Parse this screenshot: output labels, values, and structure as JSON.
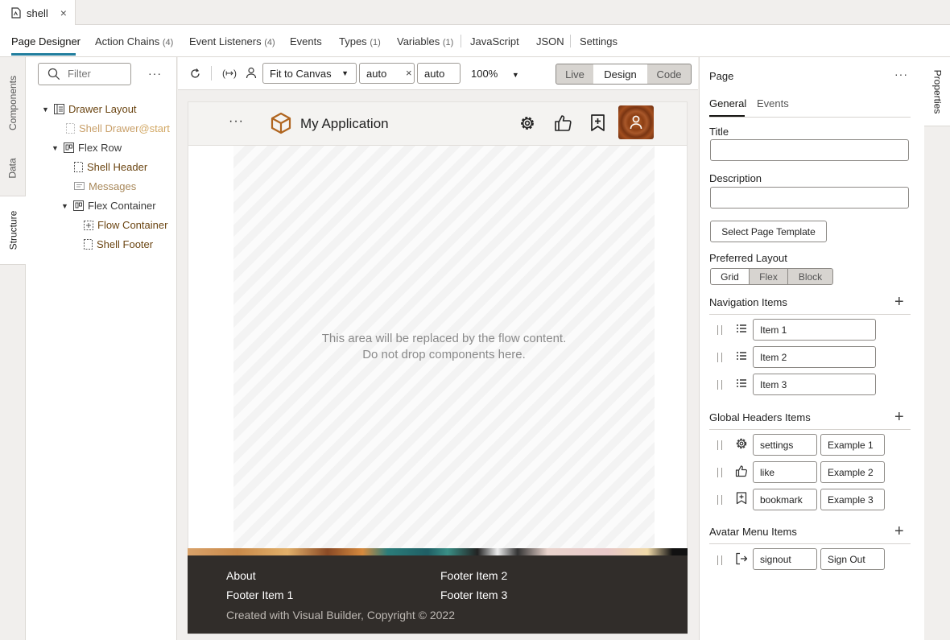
{
  "file_tab": {
    "label": "shell",
    "close": "×"
  },
  "designer_tabs": [
    {
      "label": "Page Designer",
      "count": ""
    },
    {
      "label": "Action Chains",
      "count": "(4)"
    },
    {
      "label": "Event Listeners",
      "count": "(4)"
    },
    {
      "label": "Events",
      "count": ""
    },
    {
      "label": "Types",
      "count": "(1)"
    },
    {
      "label": "Variables",
      "count": "(1)"
    },
    {
      "label": "JavaScript",
      "count": ""
    },
    {
      "label": "JSON",
      "count": ""
    },
    {
      "label": "Settings",
      "count": ""
    }
  ],
  "left_rail": {
    "components": "Components",
    "data": "Data",
    "structure": "Structure"
  },
  "structure": {
    "filter_placeholder": "Filter",
    "more": "···",
    "nodes": [
      {
        "label": "Drawer Layout",
        "slot": ""
      },
      {
        "label": "Shell Drawer",
        "slot": "@start"
      },
      {
        "label": "Flex Row",
        "slot": ""
      },
      {
        "label": "Shell Header",
        "slot": ""
      },
      {
        "label": "Messages",
        "slot": ""
      },
      {
        "label": "Flex Container",
        "slot": ""
      },
      {
        "label": "Flow Container",
        "slot": ""
      },
      {
        "label": "Shell Footer",
        "slot": ""
      }
    ]
  },
  "toolbar": {
    "fit": "Fit to Canvas",
    "width": "auto",
    "times": "×",
    "height": "auto",
    "zoom": "100%",
    "modes": [
      "Live",
      "Design",
      "Code"
    ]
  },
  "app": {
    "header_more": "···",
    "title": "My Application",
    "flow_message_1": "This area will be replaced by the flow content.",
    "flow_message_2": "Do not drop components here.",
    "footer_links": [
      "About",
      "Footer Item 1",
      "Footer Item 2",
      "Footer Item 3"
    ],
    "copyright": "Created with Visual Builder, Copyright © 2022"
  },
  "properties": {
    "panel_title": "Page",
    "more": "···",
    "tabs": [
      "General",
      "Events"
    ],
    "title_label": "Title",
    "title_value": "",
    "description_label": "Description",
    "description_value": "",
    "template_button": "Select Page Template",
    "layout_label": "Preferred Layout",
    "layout_options": [
      "Grid",
      "Flex",
      "Block"
    ],
    "nav_label": "Navigation Items",
    "nav_items": [
      "Item 1",
      "Item 2",
      "Item 3"
    ],
    "global_label": "Global Headers Items",
    "global_items": [
      {
        "icon": "settings",
        "label": "Example 1"
      },
      {
        "icon": "like",
        "label": "Example 2"
      },
      {
        "icon": "bookmark",
        "label": "Example 3"
      }
    ],
    "avatar_label": "Avatar Menu Items",
    "avatar_items": [
      {
        "icon": "signout",
        "label": "Sign Out"
      }
    ]
  },
  "right_rail": {
    "properties": "Properties"
  },
  "colors": {
    "accent": "#227e9e",
    "structure_text": "#6b4512",
    "footer_bg": "#312d2a",
    "avatar": "#9a4a1e"
  }
}
